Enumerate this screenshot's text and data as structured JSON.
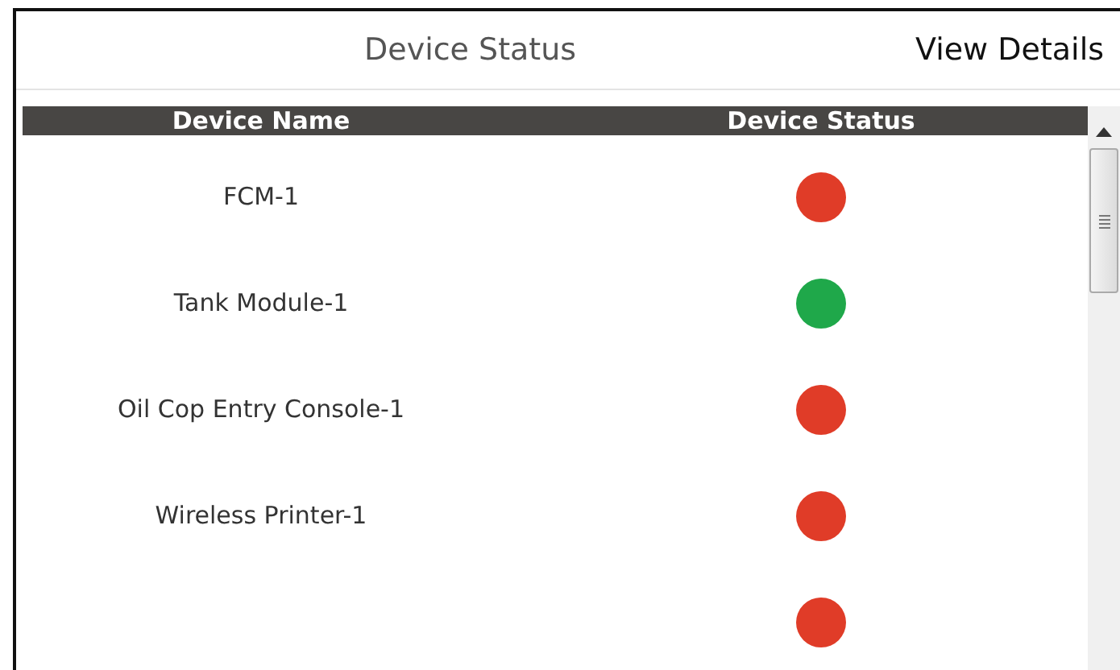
{
  "header": {
    "title": "Device Status",
    "link": "View Details"
  },
  "table": {
    "columns": [
      "Device Name",
      "Device Status"
    ],
    "rows": [
      {
        "name": "FCM-1",
        "color": "#e03c28"
      },
      {
        "name": "Tank Module-1",
        "color": "#1fa84a"
      },
      {
        "name": "Oil Cop Entry Console-1",
        "color": "#e03c28"
      },
      {
        "name": "Wireless Printer-1",
        "color": "#e03c28"
      },
      {
        "color": "#e03c28"
      }
    ]
  }
}
